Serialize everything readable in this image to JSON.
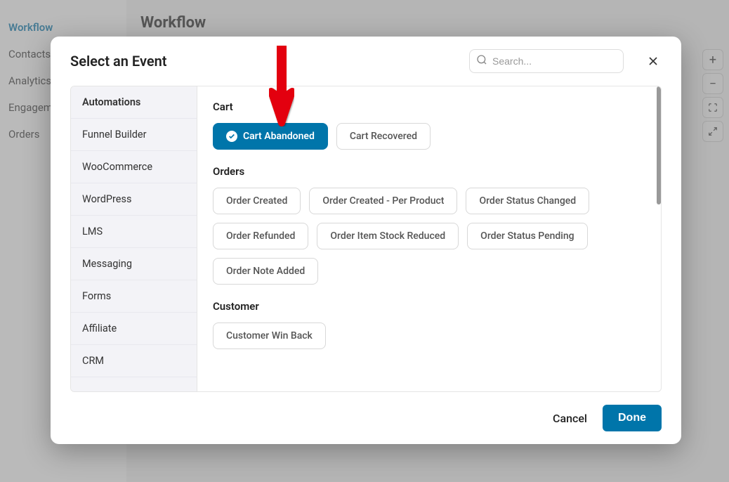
{
  "bg": {
    "nav": [
      "Workflow",
      "Contacts",
      "Analytics",
      "Engagement",
      "Orders"
    ],
    "nav_active_index": 0,
    "title": "Workflow"
  },
  "modal": {
    "title": "Select an Event",
    "search_placeholder": "Search...",
    "categories": [
      "Automations",
      "Funnel Builder",
      "WooCommerce",
      "WordPress",
      "LMS",
      "Messaging",
      "Forms",
      "Affiliate",
      "CRM"
    ],
    "category_active_index": 0,
    "sections": [
      {
        "title": "Cart",
        "events": [
          {
            "label": "Cart Abandoned",
            "selected": true
          },
          {
            "label": "Cart Recovered",
            "selected": false
          }
        ]
      },
      {
        "title": "Orders",
        "events": [
          {
            "label": "Order Created",
            "selected": false
          },
          {
            "label": "Order Created - Per Product",
            "selected": false
          },
          {
            "label": "Order Status Changed",
            "selected": false
          },
          {
            "label": "Order Refunded",
            "selected": false
          },
          {
            "label": "Order Item Stock Reduced",
            "selected": false
          },
          {
            "label": "Order Status Pending",
            "selected": false
          },
          {
            "label": "Order Note Added",
            "selected": false
          }
        ]
      },
      {
        "title": "Customer",
        "events": [
          {
            "label": "Customer Win Back",
            "selected": false
          }
        ]
      }
    ],
    "cancel": "Cancel",
    "done": "Done"
  },
  "tools": {
    "zoom_in": "+",
    "zoom_out": "−"
  }
}
